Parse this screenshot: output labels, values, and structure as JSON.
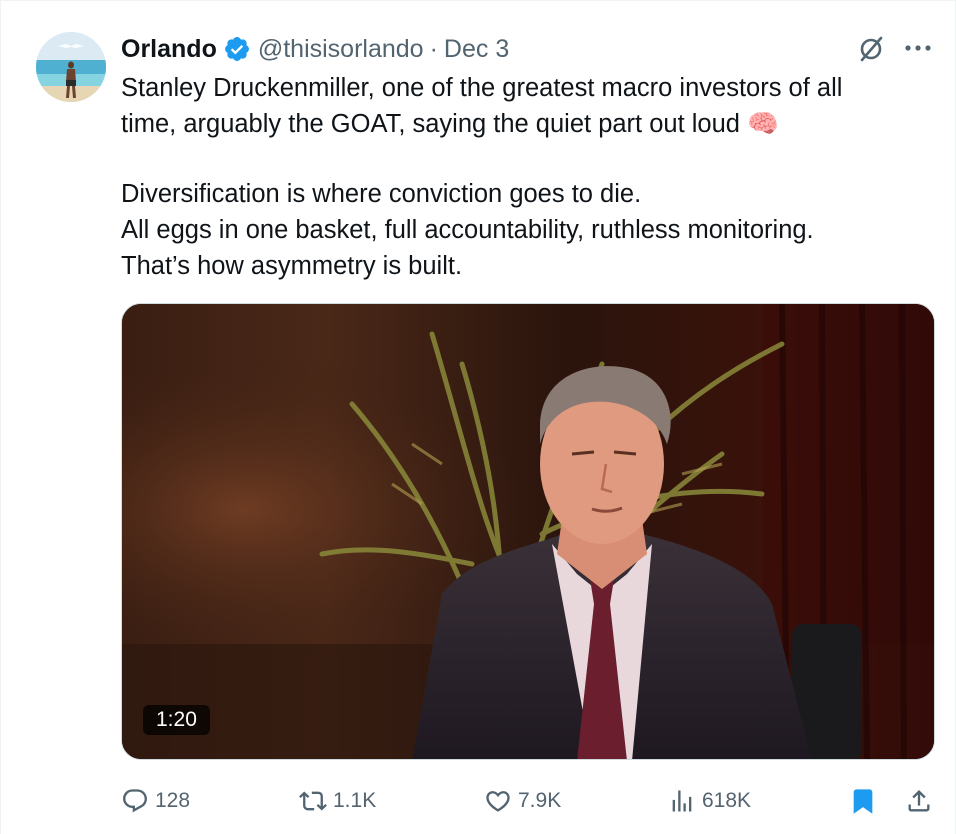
{
  "tweet": {
    "author_name": "Orlando",
    "handle": "@thisisorlando",
    "separator": "·",
    "date": "Dec 3",
    "text_lines_1": [
      "Stanley Druckenmiller, one of the greatest macro investors of all",
      "time, arguably the GOAT, saying the quiet part out loud 🧠"
    ],
    "text_lines_2": [
      "Diversification is where conviction goes to die.",
      "All eggs in one basket, full accountability, ruthless monitoring.",
      "That’s how asymmetry is built."
    ],
    "video_duration": "1:20"
  },
  "actions": {
    "replies": "128",
    "reposts": "1.1K",
    "likes": "7.9K",
    "views": "618K"
  },
  "icons": {
    "verified": "verified-badge-icon",
    "grok": "grok-icon",
    "more": "more-icon",
    "reply": "reply-icon",
    "repost": "repost-icon",
    "like": "heart-icon",
    "views": "views-icon",
    "bookmark": "bookmark-icon",
    "share": "share-icon"
  },
  "colors": {
    "text": "#0f1419",
    "secondary": "#536471",
    "verified": "#1d9bf0",
    "bookmark": "#1d9bf0"
  }
}
